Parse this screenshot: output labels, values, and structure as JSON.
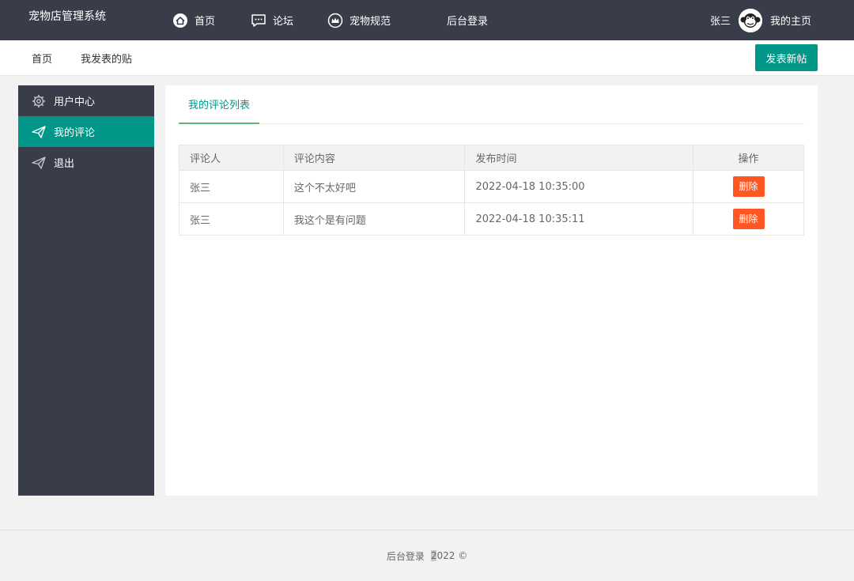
{
  "header": {
    "brand": "宠物店管理系统",
    "nav": [
      {
        "label": "首页",
        "icon": "home-icon"
      },
      {
        "label": "论坛",
        "icon": "chat-icon"
      },
      {
        "label": "宠物规范",
        "icon": "crown-icon"
      },
      {
        "label": "后台登录",
        "icon": ""
      }
    ],
    "user_name": "张三",
    "home_link": "我的主页"
  },
  "subbar": {
    "crumbs": [
      "首页",
      "我发表的贴"
    ],
    "new_post_label": "发表新帖"
  },
  "sidebar": {
    "items": [
      {
        "label": "用户中心",
        "icon": "gear-icon",
        "active": false
      },
      {
        "label": "我的评论",
        "icon": "paper-plane-icon",
        "active": true
      },
      {
        "label": "退出",
        "icon": "paper-plane-icon",
        "active": false
      }
    ]
  },
  "main": {
    "tab_label": "我的评论列表",
    "table": {
      "headers": [
        "评论人",
        "评论内容",
        "发布时间",
        "操作"
      ],
      "rows": [
        {
          "commenter": "张三",
          "content": "这个不太好吧",
          "time": "2022-04-18 10:35:00",
          "action": "删除"
        },
        {
          "commenter": "张三",
          "content": "我这个是有问题",
          "time": "2022-04-18 10:35:11",
          "action": "删除"
        }
      ]
    }
  },
  "footer": {
    "admin_link": "后台登录",
    "year_first": "2",
    "year_rest": "022 ©"
  },
  "colors": {
    "topbar": "#393d49",
    "accent": "#009688",
    "danger": "#ff5722"
  }
}
